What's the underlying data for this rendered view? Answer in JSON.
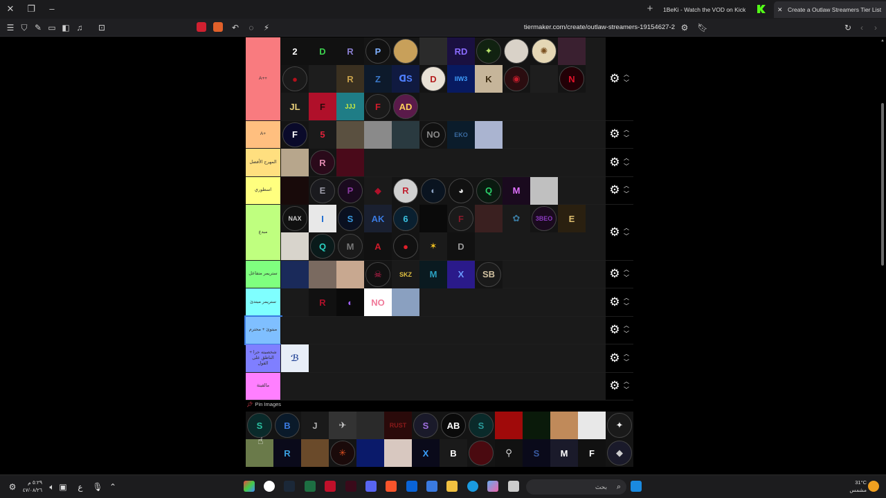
{
  "browser": {
    "tabs": [
      {
        "label": "1BeKi - Watch the VOD on Kick",
        "active": false
      },
      {
        "label": "Create a Outlaw Streamers Tier List",
        "active": true
      }
    ],
    "url": "tiermaker.com/create/outlaw-streamers-19154627-2"
  },
  "tiers": [
    {
      "label": "A++",
      "color": "#f97b7f",
      "items": [
        {
          "t": "2",
          "bg": "#111",
          "fg": "#fff"
        },
        {
          "t": "D",
          "bg": "#111",
          "fg": "#3ccf4e"
        },
        {
          "t": "R",
          "bg": "#111",
          "fg": "#8a7fd0"
        },
        {
          "t": "P",
          "bg": "#111",
          "fg": "#7fb0ff",
          "r": 1
        },
        {
          "t": "",
          "bg": "#c8a05a",
          "fg": "#fff",
          "r": 1
        },
        {
          "t": "",
          "bg": "#2b2b2b",
          "fg": "#fff"
        },
        {
          "t": "RD",
          "bg": "#1a1040",
          "fg": "#8a6cff"
        },
        {
          "t": "✦",
          "bg": "#121",
          "fg": "#b7e36a",
          "r": 1
        },
        {
          "t": "",
          "bg": "#d9d2c8",
          "fg": "#333",
          "r": 1
        },
        {
          "t": "✺",
          "bg": "#e5d7b5",
          "fg": "#7a5020",
          "r": 1
        },
        {
          "t": "",
          "bg": "#3a2030",
          "fg": "#fff"
        },
        {
          "t": "●",
          "bg": "#1a1a1a",
          "fg": "#b3101b",
          "r": 1
        },
        {
          "t": "",
          "bg": "#1d1d1d",
          "fg": "#555"
        },
        {
          "t": "R",
          "bg": "#3a3020",
          "fg": "#c9a24c"
        },
        {
          "t": "Z",
          "bg": "#0d1a2b",
          "fg": "#3a78c9"
        },
        {
          "t": "ᗡS",
          "bg": "#101a40",
          "fg": "#4f7fff"
        },
        {
          "t": "D",
          "bg": "#e9e2d6",
          "fg": "#b41e1e",
          "r": 1
        },
        {
          "t": "IIW3",
          "bg": "#081a60",
          "fg": "#3fa0ff"
        },
        {
          "t": "K",
          "bg": "#c6b59a",
          "fg": "#3a2a10"
        },
        {
          "t": "◉",
          "bg": "#2b0d10",
          "fg": "#c21c2b",
          "r": 1
        },
        {
          "t": "",
          "bg": "#1e1e1e",
          "fg": "#555"
        },
        {
          "t": "N",
          "bg": "#220006",
          "fg": "#e0122a",
          "r": 1
        },
        {
          "t": "JL",
          "bg": "#1a1a1a",
          "fg": "#e7cf7a"
        },
        {
          "t": "F",
          "bg": "#b0102a",
          "fg": "#2a0a0a"
        },
        {
          "t": "JJJ",
          "bg": "#1f7d86",
          "fg": "#d6f23c"
        },
        {
          "t": "F",
          "bg": "#1a1a1a",
          "fg": "#d21b2b",
          "r": 1
        },
        {
          "t": "AD",
          "bg": "#5a1a4a",
          "fg": "#ffcf5a",
          "r": 1
        }
      ]
    },
    {
      "label": "A+",
      "color": "#ffbf7f",
      "items": [
        {
          "t": "F",
          "bg": "#0a0a2a",
          "fg": "#fff",
          "r": 1
        },
        {
          "t": "5",
          "bg": "#1a1a1a",
          "fg": "#e0223a"
        },
        {
          "t": "",
          "bg": "#5a5040",
          "fg": "#ccc"
        },
        {
          "t": "",
          "bg": "#8a8a8a",
          "fg": "#ddd"
        },
        {
          "t": "",
          "bg": "#2a3a40",
          "fg": "#ccc"
        },
        {
          "t": "NO",
          "bg": "#111",
          "fg": "#888",
          "r": 1
        },
        {
          "t": "EKO",
          "bg": "#0b1c2b",
          "fg": "#3a6aa0"
        },
        {
          "t": "",
          "bg": "#aab4d0",
          "fg": "#fff"
        }
      ]
    },
    {
      "label": "المهرج الأفضل",
      "color": "#ffdf7f",
      "items": [
        {
          "t": "",
          "bg": "#b7a68c",
          "fg": "#fff"
        },
        {
          "t": "R",
          "bg": "#2a0a1a",
          "fg": "#e08ab0",
          "r": 1
        },
        {
          "t": "",
          "bg": "#4a0a1a",
          "fg": "#fff"
        }
      ]
    },
    {
      "label": "اسطوري",
      "color": "#ffff7f",
      "items": [
        {
          "t": "",
          "bg": "#180a0a",
          "fg": "#600"
        },
        {
          "t": "E",
          "bg": "#1a1a1e",
          "fg": "#9a9aa6",
          "r": 1
        },
        {
          "t": "P",
          "bg": "#1a0a1e",
          "fg": "#8a3aa0",
          "r": 1
        },
        {
          "t": "◆",
          "bg": "#1a1a1a",
          "fg": "#b0102a"
        },
        {
          "t": "R",
          "bg": "#d0d0d0",
          "fg": "#c02030",
          "r": 1
        },
        {
          "t": "◐",
          "bg": "#0a1420",
          "fg": "#8aa0c0",
          "r": 1
        },
        {
          "t": "◕",
          "bg": "#111",
          "fg": "#ddd",
          "r": 1
        },
        {
          "t": "Q",
          "bg": "#0a1a10",
          "fg": "#2ad06a",
          "r": 1
        },
        {
          "t": "M",
          "bg": "#1a0a1e",
          "fg": "#e070ff"
        },
        {
          "t": "",
          "bg": "#c0c0c0",
          "fg": "#333"
        }
      ]
    },
    {
      "label": "مبدع",
      "color": "#bfff7f",
      "items": [
        {
          "t": "NAX",
          "bg": "#111",
          "fg": "#ccc",
          "r": 1
        },
        {
          "t": "I",
          "bg": "#e8e8e8",
          "fg": "#1a6ad0"
        },
        {
          "t": "S",
          "bg": "#0a1020",
          "fg": "#3a9ae0",
          "r": 1
        },
        {
          "t": "AK",
          "bg": "#1a2030",
          "fg": "#3a7ae0"
        },
        {
          "t": "6",
          "bg": "#0a2030",
          "fg": "#3ac0e0",
          "r": 1
        },
        {
          "t": "",
          "bg": "#0a0a0a",
          "fg": "#fff"
        },
        {
          "t": "F",
          "bg": "#1a1a1a",
          "fg": "#8a1a2a",
          "r": 1
        },
        {
          "t": "",
          "bg": "#3a2020",
          "fg": "#fff"
        },
        {
          "t": "✿",
          "bg": "#1a1a1a",
          "fg": "#3a7aa0"
        },
        {
          "t": "3BEO",
          "bg": "#1a0a1e",
          "fg": "#8a3ac0",
          "r": 1
        },
        {
          "t": "E",
          "bg": "#2a2010",
          "fg": "#e0c070"
        },
        {
          "t": "",
          "bg": "#d8d4cc",
          "fg": "#333"
        },
        {
          "t": "Q",
          "bg": "#0a1a1a",
          "fg": "#2ad0c0",
          "r": 1
        },
        {
          "t": "M",
          "bg": "#1a1a1a",
          "fg": "#777",
          "r": 1
        },
        {
          "t": "A",
          "bg": "#111",
          "fg": "#d01a2a"
        },
        {
          "t": "●",
          "bg": "#111",
          "fg": "#e0202a",
          "r": 1
        },
        {
          "t": "✶",
          "bg": "#1a1a1a",
          "fg": "#f0c020"
        },
        {
          "t": "D",
          "bg": "#111",
          "fg": "#999"
        }
      ]
    },
    {
      "label": "ستريمر متفاعل",
      "color": "#7fff7f",
      "items": [
        {
          "t": "",
          "bg": "#1a2a5a",
          "fg": "#e0a050"
        },
        {
          "t": "",
          "bg": "#7a6a60",
          "fg": "#fff"
        },
        {
          "t": "",
          "bg": "#c8a890",
          "fg": "#fff"
        },
        {
          "t": "☠",
          "bg": "#111",
          "fg": "#d02050",
          "r": 1
        },
        {
          "t": "SKZ",
          "bg": "#1a1a1a",
          "fg": "#e0c040"
        },
        {
          "t": "M",
          "bg": "#0a1a20",
          "fg": "#2aa0c0"
        },
        {
          "t": "X",
          "bg": "#2a1a8a",
          "fg": "#6a9aff"
        },
        {
          "t": "SB",
          "bg": "#1a1a1a",
          "fg": "#d0c0a0",
          "r": 1
        }
      ]
    },
    {
      "label": "ستريمر مبتدئ",
      "color": "#7fffff",
      "items": [
        {
          "t": "",
          "bg": "#1a1a1a",
          "fg": "#666"
        },
        {
          "t": "R",
          "bg": "#111",
          "fg": "#b0102a"
        },
        {
          "t": "◐",
          "bg": "#0a0a0a",
          "fg": "#a060ff"
        },
        {
          "t": "NO",
          "bg": "#fff",
          "fg": "#f07a9a"
        },
        {
          "t": "",
          "bg": "#8aa0c0",
          "fg": "#fff"
        }
      ]
    },
    {
      "label": "مبتوئ + محترم",
      "color": "#7fbfff",
      "items": [
        {
          "t": "",
          "bg": "#1a1a1a",
          "fg": "#555"
        }
      ]
    },
    {
      "label": "شخصيته حرا + الناطق على القول",
      "color": "#7f7fff",
      "items": [
        {
          "t": "ℬ",
          "bg": "#e8eef8",
          "fg": "#2a4a9a"
        }
      ]
    },
    {
      "label": "مالقيتة",
      "color": "#ff7fff",
      "items": []
    }
  ],
  "pool": {
    "title": "Pin Images",
    "items": [
      {
        "t": "S",
        "bg": "#0a2a2a",
        "fg": "#2ac0a0",
        "r": 1
      },
      {
        "t": "B",
        "bg": "#0a1a2a",
        "fg": "#3a7ae0",
        "r": 1
      },
      {
        "t": "J",
        "bg": "#1a1a1a",
        "fg": "#aaa"
      },
      {
        "t": "✈",
        "bg": "#333",
        "fg": "#ccc"
      },
      {
        "t": "",
        "bg": "#2a2a2a",
        "fg": "#ddd"
      },
      {
        "t": "RUST",
        "bg": "#2a0a0a",
        "fg": "#8a1a1a"
      },
      {
        "t": "S",
        "bg": "#1a1a2a",
        "fg": "#a070e0",
        "r": 1
      },
      {
        "t": "AB",
        "bg": "#0a0a0a",
        "fg": "#fff",
        "r": 1
      },
      {
        "t": "S",
        "bg": "#0a2a2a",
        "fg": "#2a9a9a",
        "r": 1
      },
      {
        "t": "",
        "bg": "#a00a0a",
        "fg": "#111"
      },
      {
        "t": "",
        "bg": "#0a1a0a",
        "fg": "#777"
      },
      {
        "t": "",
        "bg": "#c08a5a",
        "fg": "#fff"
      },
      {
        "t": "",
        "bg": "#e8e8e8",
        "fg": "#333"
      },
      {
        "t": "✦",
        "bg": "#1a1a1a",
        "fg": "#eee",
        "r": 1
      },
      {
        "t": "",
        "bg": "#6a7a4a",
        "fg": "#fff"
      },
      {
        "t": "R",
        "bg": "#0a0a1a",
        "fg": "#3aa0e0"
      },
      {
        "t": "",
        "bg": "#6a4a2a",
        "fg": "#fff"
      },
      {
        "t": "✳",
        "bg": "#1a0a0a",
        "fg": "#e05020",
        "r": 1
      },
      {
        "t": "",
        "bg": "#0a1a6a",
        "fg": "#6ab0ff"
      },
      {
        "t": "",
        "bg": "#d8c8c0",
        "fg": "#fff"
      },
      {
        "t": "X",
        "bg": "#0a0a1a",
        "fg": "#3aa0ff"
      },
      {
        "t": "B",
        "bg": "#1a1a1a",
        "fg": "#fff"
      },
      {
        "t": "",
        "bg": "#4a0a10",
        "fg": "#c01020",
        "r": 1
      },
      {
        "t": "⚲",
        "bg": "#111",
        "fg": "#ddd"
      },
      {
        "t": "S",
        "bg": "#0a0a1a",
        "fg": "#3a5aa0"
      },
      {
        "t": "M",
        "bg": "#1a1a2a",
        "fg": "#fff"
      },
      {
        "t": "F",
        "bg": "#111",
        "fg": "#fff"
      },
      {
        "t": "◆",
        "bg": "#1a1a2a",
        "fg": "#ccc",
        "r": 1
      }
    ]
  },
  "taskbar": {
    "clock_time": "٥:٢٩ م",
    "clock_date": "٤٧/٠٨/٢٦",
    "search_placeholder": "بحث",
    "weather_temp": "31°C",
    "weather_text": "مشمس",
    "lang": "ع"
  }
}
